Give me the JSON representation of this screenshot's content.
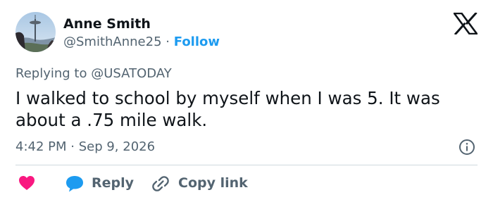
{
  "author": {
    "name": "Anne Smith",
    "handle": "@SmithAnne25",
    "separator": "·",
    "follow_label": "Follow",
    "avatar_icon": "avatar-photo-space-needle"
  },
  "brand": {
    "logo_icon": "x-logo-icon"
  },
  "reply_context": {
    "prefix": "Replying to",
    "mention": "@USATODAY"
  },
  "tweet": {
    "text": "I walked to school by myself when I was 5. It was about a .75 mile walk.",
    "timestamp": "4:42 PM · Sep 9, 2026"
  },
  "actions": {
    "like_icon": "heart-icon",
    "reply_label": "Reply",
    "reply_icon": "speech-bubble-icon",
    "copy_label": "Copy link",
    "copy_icon": "link-icon",
    "info_icon": "info-icon"
  },
  "colors": {
    "accent": "#1d9bf0",
    "like": "#f91880",
    "secondary_text": "#536471",
    "primary_text": "#0f1419",
    "divider": "#cfd9de"
  }
}
